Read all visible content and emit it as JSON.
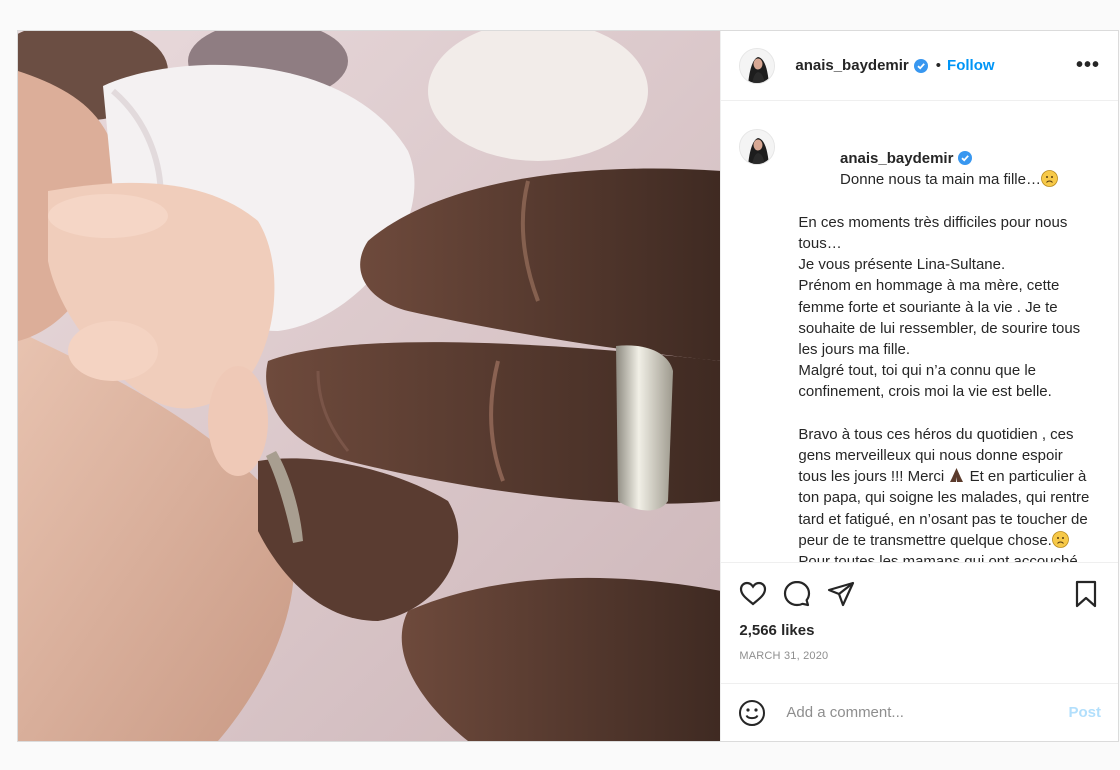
{
  "post": {
    "username": "anais_baydemir",
    "follow_label": "Follow",
    "more_label": "•••",
    "separator": "•",
    "caption_lines": [
      "Donne nous ta main ma fille…",
      "En ces moments très difficiles pour nous tous…",
      "Je vous présente Lina-Sultane.",
      "Prénom en hommage à ma mère, cette femme forte et souriante à la vie . Je te souhaite de lui ressembler, de sourire tous les jours ma fille.",
      "Malgré tout, toi qui n’a connu que le confinement, crois moi la vie est belle.",
      "",
      "Bravo à tous ces héros du quotidien , ces gens merveilleux qui nous donne espoir tous les jours !!! Merci",
      "Et en particulier à ton papa, qui soigne les malades, qui rentre tard et fatigué, en n’osant pas te toucher de peur de te transmettre quelque chose.",
      "Pour toutes les mamans qui ont accouché dans des conditions difficiles en ce moment"
    ],
    "likes": "2,566 likes",
    "date": "MARCH 31, 2020",
    "comment_placeholder": "Add a comment...",
    "post_label": "Post"
  },
  "colors": {
    "link_blue": "#0095f6",
    "post_disabled": "#b2dffc",
    "border": "#dbdbdb"
  },
  "icons": [
    "verified-badge-icon",
    "heart-icon",
    "comment-icon",
    "share-icon",
    "bookmark-icon",
    "smiley-icon",
    "sad-face-emoji",
    "prayer-hands-emoji"
  ]
}
